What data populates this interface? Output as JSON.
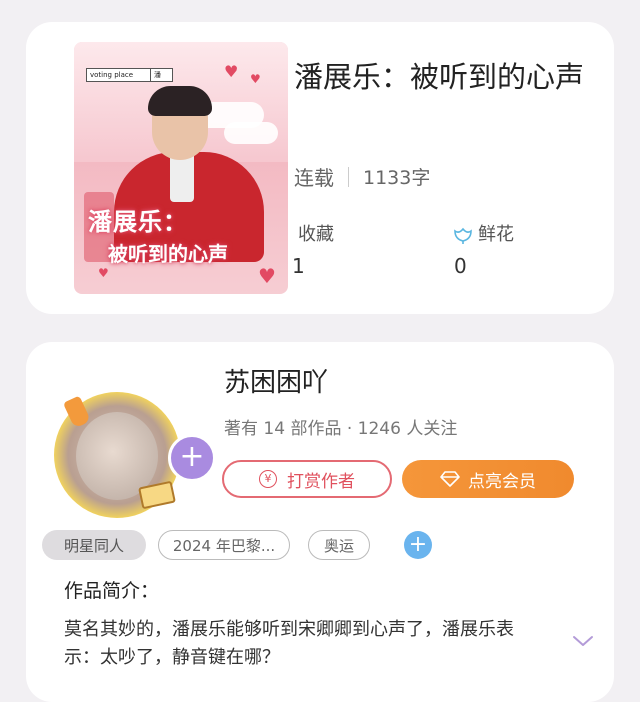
{
  "book": {
    "title": "潘展乐：被听到的心声",
    "status": "连载",
    "word_count": "1133字",
    "favorites_label": "收藏",
    "favorites_value": "1",
    "flowers_label": "鲜花",
    "flowers_value": "0",
    "cover_title_line1": "潘展乐：",
    "cover_title_line2": "被听到的心声",
    "cover_tag": "voting place",
    "cover_tag2": "潘"
  },
  "author": {
    "name": "苏困困吖",
    "stats": "著有 14 部作品 · 1246 人关注",
    "tip_button": "打赏作者",
    "vip_button": "点亮会员",
    "follow_plus": "+"
  },
  "tags": [
    {
      "label": "明星同人"
    },
    {
      "label": "2024 年巴黎..."
    },
    {
      "label": "奥运"
    }
  ],
  "add_tag": "+",
  "intro": {
    "title": "作品简介：",
    "text": "莫名其妙的，潘展乐能够听到宋卿卿到心声了，潘展乐表示：太吵了，静音键在哪？"
  },
  "colors": {
    "accent_purple": "#a98be0",
    "tip_red": "#e0515e",
    "vip_orange": "#f5963a",
    "add_blue": "#6ab4ee"
  }
}
